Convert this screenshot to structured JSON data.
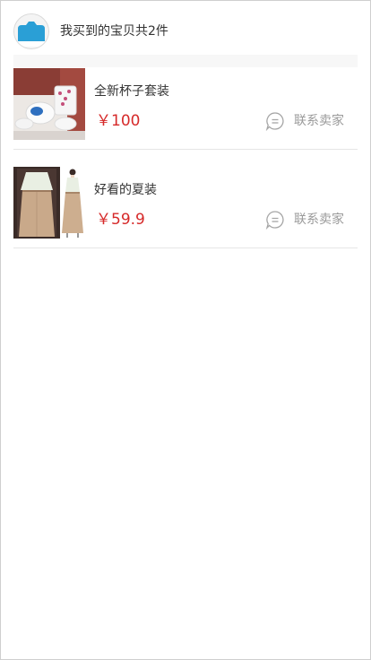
{
  "header": {
    "avatar_icon": "avatar-placeholder-icon",
    "title": "我买到的宝贝共2件"
  },
  "items": [
    {
      "image_icon": "cup-set-photo",
      "name": "全新杯子套装",
      "price": "￥100",
      "contact_icon": "chat-bubble-icon",
      "contact_label": "联系卖家"
    },
    {
      "image_icon": "summer-outfit-photo",
      "name": "好看的夏装",
      "price": "￥59.9",
      "contact_icon": "chat-bubble-icon",
      "contact_label": "联系卖家"
    }
  ],
  "colors": {
    "price": "#d62a2a",
    "muted_text": "#9a9a9a",
    "divider": "#e6e6e6",
    "avatar_blue": "#2a9fd6"
  }
}
